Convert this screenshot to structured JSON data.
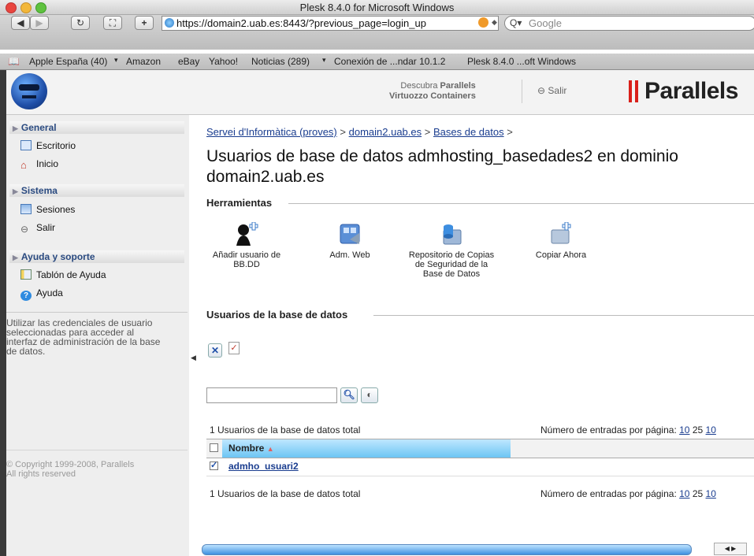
{
  "window": {
    "title": "Plesk 8.4.0 for Microsoft Windows"
  },
  "toolbar": {
    "url": "https://domain2.uab.es:8443/?previous_page=login_up",
    "search_placeholder": "Google"
  },
  "bookmarks": [
    "Apple España (40)",
    "Amazon",
    "eBay",
    "Yahoo!",
    "Noticias (289)",
    "Conexión de ...ndar 10.1.2",
    "Plesk 8.4.0 ...oft Windows"
  ],
  "header": {
    "promo_line1_prefix": "Descubra ",
    "promo_line1_bold": "Parallels",
    "promo_line2": "Virtuozzo Containers",
    "salir": "Salir",
    "brand": "Parallels"
  },
  "sidebar": {
    "sections": [
      {
        "title": "General",
        "items": [
          "Escritorio",
          "Inicio"
        ]
      },
      {
        "title": "Sistema",
        "items": [
          "Sesiones",
          "Salir"
        ]
      },
      {
        "title": "Ayuda y soporte",
        "items": [
          "Tablón de Ayuda",
          "Ayuda"
        ]
      }
    ],
    "hint": "Utilizar las credenciales de usuario seleccionadas para acceder al interfaz de administración de la base de datos.",
    "copyright_line1": "© Copyright 1999-2008, Parallels",
    "copyright_line2": "All rights reserved"
  },
  "main": {
    "breadcrumb": {
      "items": [
        "Servei d'Informàtica (proves)",
        "domain2.uab.es",
        "Bases de datos"
      ],
      "separator": ">"
    },
    "title": "Usuarios de base de datos admhosting_basedades2 en dominio domain2.uab.es",
    "tools_group": "Herramientas",
    "tools": [
      {
        "label": "Añadir usuario de BB.DD",
        "icon": "add-user-icon"
      },
      {
        "label": "Adm. Web",
        "icon": "web-admin-icon"
      },
      {
        "label": "Repositorio de Copias de Seguridad de la Base de Datos",
        "icon": "backup-repository-icon"
      },
      {
        "label": "Copiar Ahora",
        "icon": "backup-now-icon"
      }
    ],
    "users_group": "Usuarios de la base de datos",
    "total_text": "1 Usuarios de la base de datos total",
    "per_page_label": "Número de entradas por página:",
    "per_page_options": [
      "10",
      "25",
      "10"
    ],
    "table": {
      "column_name": "Nombre",
      "sort_indicator": "▲",
      "rows": [
        {
          "name": "admho_usuari2",
          "checked": true
        }
      ]
    }
  },
  "colors": {
    "link": "#1a3d8f",
    "section_header_text": "#2a4a80",
    "column_header": "#6cc5f3",
    "brand_red": "#d9201a"
  }
}
